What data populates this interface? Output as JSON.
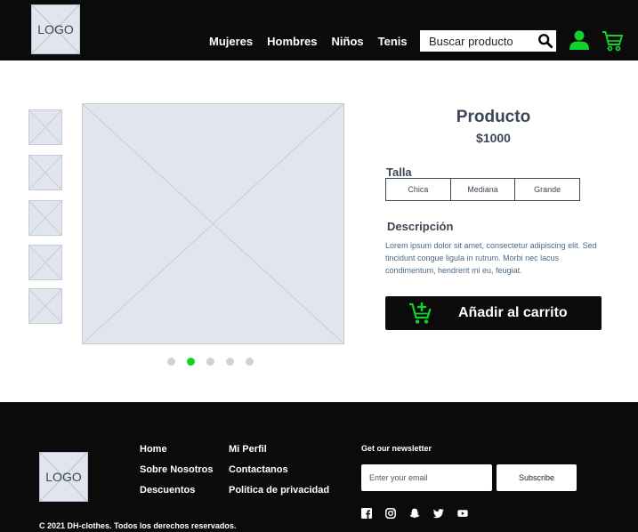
{
  "header": {
    "logo_text": "LOGO",
    "nav": [
      "Mujeres",
      "Hombres",
      "Niños",
      "Tenis"
    ],
    "search_placeholder": "Buscar producto"
  },
  "product": {
    "title": "Producto",
    "price": "$1000",
    "size_label": "Talla",
    "sizes": [
      "Chica",
      "Mediana",
      "Grande"
    ],
    "description_label": "Descripción",
    "description": "Lorem ipsum dolor sit amet, consectetur adipiscing elit. Sed tincidunt congue ligula in rutrum. Morbi nec lacus condimentum, hendrerit mi eu, feugiat.",
    "add_to_cart": "Añadir al carrito",
    "thumbnail_count": 5,
    "carousel_dots": 5,
    "active_dot": 2
  },
  "footer": {
    "logo_text": "LOGO",
    "links_col1": [
      "Home",
      "Sobre Nosotros",
      "Descuentos"
    ],
    "links_col2": [
      "Mi Perfil",
      "Contactanos",
      "Politica de privacidad"
    ],
    "newsletter_title": "Get our newsletter",
    "email_placeholder": "Enter your email",
    "subscribe_label": "Subscribe",
    "socials": [
      "facebook-icon",
      "instagram-icon",
      "snapchat-icon",
      "twitter-icon",
      "youtube-icon"
    ],
    "copyright": "C 2021 DH-clothes. Todos los derechos reservados."
  },
  "colors": {
    "dark": "#0b0b0b",
    "accent": "#11d12c",
    "placeholder_gray": "#e1e6ee",
    "text": "#3c4655"
  }
}
